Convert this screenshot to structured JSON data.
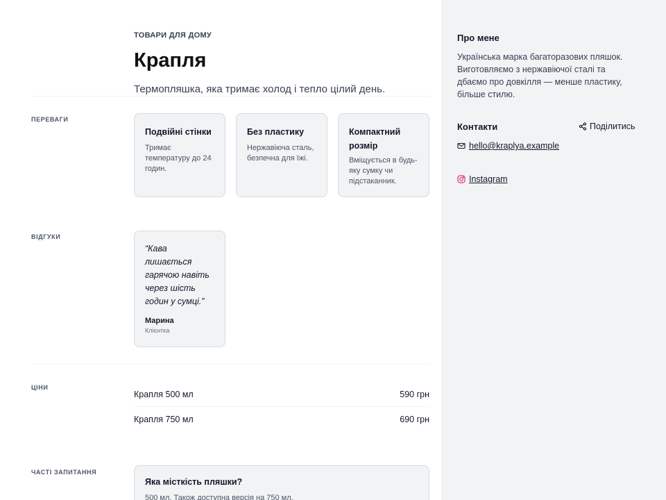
{
  "hero": {
    "eyebrow": "ТОВАРИ ДЛЯ ДОМУ",
    "title": "Крапля",
    "subtitle": "Термопляшка, яка тримає холод і тепло цілий день."
  },
  "benefits": {
    "label": "ПЕРЕВАГИ",
    "cards": [
      {
        "title": "Подвійні стінки",
        "text": "Тримає температуру до 24 годин."
      },
      {
        "title": "Без пластику",
        "text": "Нержавіюча сталь, безпечна для їжі."
      },
      {
        "title": "Компактний розмір",
        "text": "Вміщується в будь-яку сумку чи підстаканник."
      }
    ]
  },
  "reviews": {
    "label": "ВІДГУКИ",
    "items": [
      {
        "quote": "“Кава лишається гарячою навіть через шість годин у сумці.”",
        "author": "Марина",
        "role": "Клієнтка"
      }
    ]
  },
  "prices": {
    "label": "ЦІНИ",
    "items": [
      {
        "name": "Крапля 500 мл",
        "price": "590 грн"
      },
      {
        "name": "Крапля 750 мл",
        "price": "690 грн"
      }
    ]
  },
  "faq": {
    "label": "ЧАСТІ ЗАПИТАННЯ",
    "items": [
      {
        "question": "Яка місткість пляшки?",
        "answer": "500 мл. Також доступна версія на 750 мл."
      }
    ]
  },
  "sidebar": {
    "about_heading": "Про мене",
    "about_text": "Українська марка багаторазових пляшок. Виготовляємо з нержавіючої сталі та дбаємо про довкілля — менше пластику, більше стилю.",
    "contacts_heading": "Контакти",
    "share_label": "Поділитись",
    "email": "hello@kraplya.example",
    "instagram": "Instagram"
  },
  "colors": {
    "sidebar_bg": "#f1f3f5",
    "card_bg": "#f1f3f5",
    "instagram_accent": "#e1306c"
  }
}
